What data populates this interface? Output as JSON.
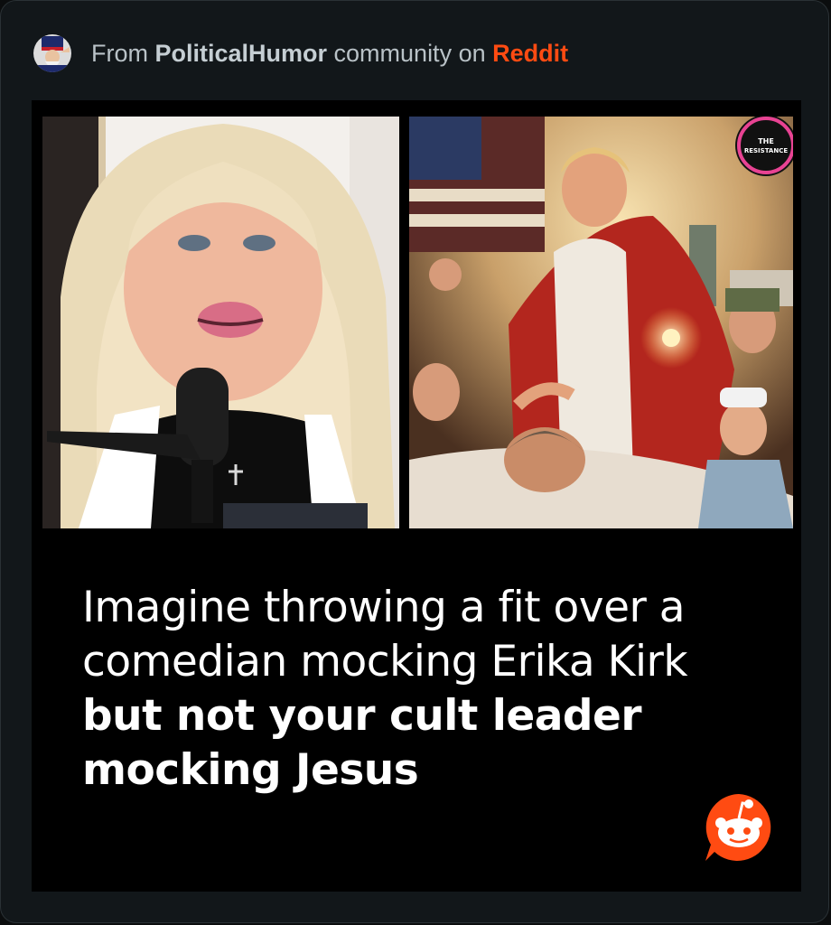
{
  "header": {
    "prefix": "From ",
    "community": "PoliticalHumor",
    "middle": " community on ",
    "platform": "Reddit"
  },
  "post": {
    "caption_regular": "Imagine throwing a fit over a comedian mocking Erika Kirk ",
    "caption_bold": "but not your cult leader mocking Jesus",
    "watermark": "THE RESISTANCE"
  },
  "colors": {
    "background": "#12171a",
    "post_background": "#000000",
    "reddit_orange": "#ff4b12",
    "header_text": "#b9c2c7"
  },
  "icons": {
    "avatar": "uncle-sam-avatar",
    "logo": "reddit-snoo-logo"
  }
}
